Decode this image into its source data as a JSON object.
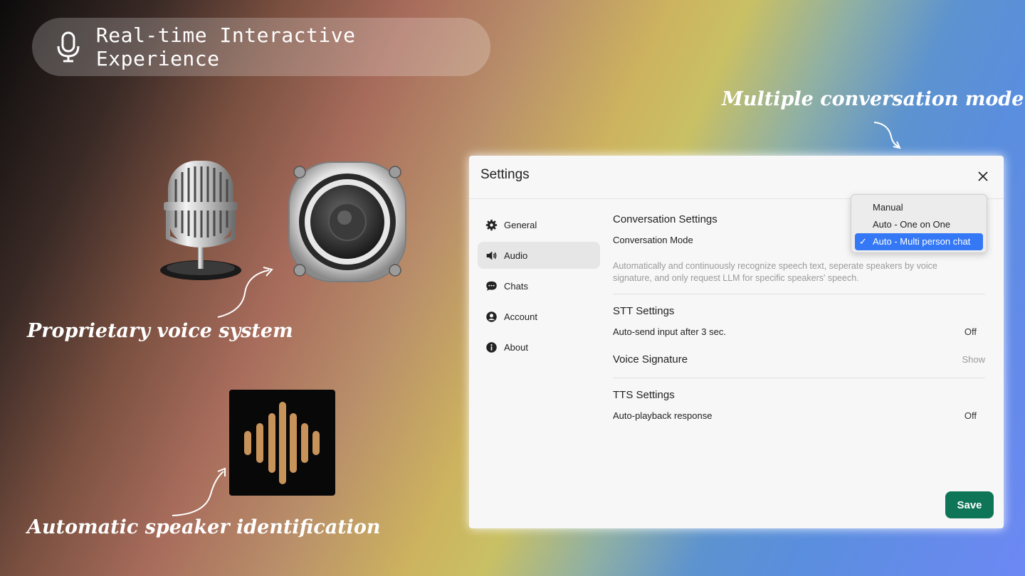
{
  "badge": {
    "title": "Real-time Interactive Experience",
    "icon": "microphone-icon"
  },
  "annotations": {
    "conversation_mode": "Multiple conversation mode",
    "voice_system": "Proprietary voice system",
    "speaker_id": "Automatic speaker identification"
  },
  "settings": {
    "title": "Settings",
    "close_icon": "close-icon",
    "sidebar": {
      "items": [
        {
          "label": "General",
          "icon": "gear-icon"
        },
        {
          "label": "Audio",
          "icon": "speaker-icon"
        },
        {
          "label": "Chats",
          "icon": "chat-bubble-icon"
        },
        {
          "label": "Account",
          "icon": "user-icon"
        },
        {
          "label": "About",
          "icon": "info-icon"
        }
      ],
      "active": "Audio"
    },
    "conversation": {
      "section_title": "Conversation Settings",
      "mode_label": "Conversation Mode",
      "description": "Automatically and continuously recognize speech text, seperate speakers by voice signature, and only request LLM for specific speakers' speech.",
      "options": [
        "Manual",
        "Auto - One on One",
        "Auto - Multi person chat"
      ],
      "selected": "Auto - Multi person chat"
    },
    "stt": {
      "section_title": "STT Settings",
      "auto_send_label": "Auto-send input after 3 sec.",
      "auto_send_value": "Off",
      "voice_signature_label": "Voice Signature",
      "voice_signature_action": "Show"
    },
    "tts": {
      "section_title": "TTS Settings",
      "autoplay_label": "Auto-playback response",
      "autoplay_value": "Off"
    },
    "save_label": "Save"
  },
  "colors": {
    "save": "#0e7556",
    "selected": "#3478f6",
    "waveform": "#c8935a"
  }
}
